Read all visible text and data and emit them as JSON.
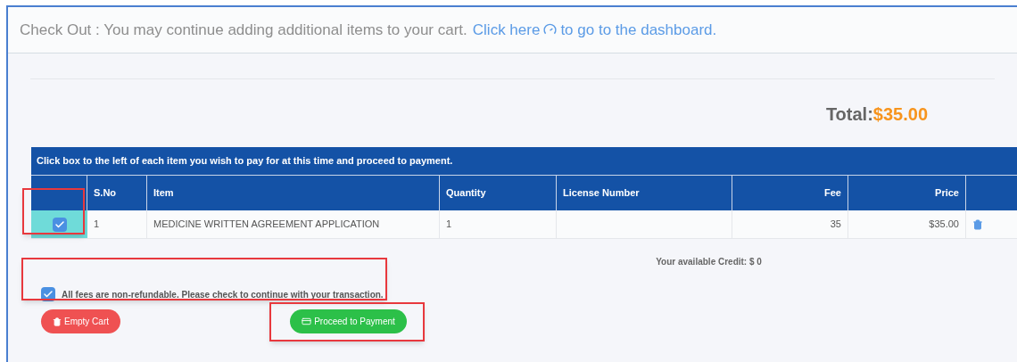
{
  "header": {
    "text": "Check Out : You may continue adding additional items to your cart.",
    "link_before": "Click here",
    "link_after": "to go to the dashboard."
  },
  "total": {
    "label": "Total:",
    "amount": "$35.00"
  },
  "table": {
    "caption": "Click box to the left of each item you wish to pay for at this time and proceed to payment.",
    "columns": [
      "S.No",
      "Item",
      "Quantity",
      "License Number",
      "Fee",
      "Price"
    ],
    "rows": [
      {
        "checked": true,
        "highlighted": true,
        "cells": [
          "1",
          "MEDICINE WRITTEN AGREEMENT APPLICATION",
          "1",
          "",
          "35",
          "$35.00"
        ]
      }
    ]
  },
  "credit": "Your available Credit: $ 0",
  "agreement": {
    "checked": true,
    "highlighted": true,
    "label": "All fees are non-refundable. Please check to continue with your transaction."
  },
  "buttons": [
    {
      "kind": "danger",
      "label": "Empty Cart",
      "highlighted": false
    },
    {
      "kind": "success",
      "label": "Proceed to Payment",
      "highlighted": true
    }
  ]
}
